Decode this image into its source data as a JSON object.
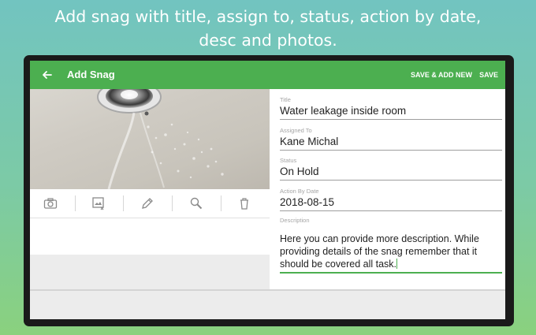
{
  "headline": {
    "line1": "Add snag with title, assign to, status,  action by date,",
    "line2": "desc and photos."
  },
  "appbar": {
    "title": "Add Snag",
    "back_icon": "arrow-back-icon",
    "save_add_new_label": "SAVE & ADD NEW",
    "save_label": "SAVE",
    "color": "#4caf50"
  },
  "photo_toolbar": {
    "icons": [
      "camera-icon",
      "gallery-icon",
      "pencil-icon",
      "zoom-icon",
      "trash-icon"
    ]
  },
  "form": {
    "title": {
      "label": "Title",
      "value": "Water leakage inside room"
    },
    "assigned_to": {
      "label": "Assigned To",
      "value": "Kane Michal"
    },
    "status": {
      "label": "Status",
      "value": "On Hold"
    },
    "action_by_date": {
      "label": "Action By Date",
      "value": "2018-08-15"
    },
    "description": {
      "label": "Description",
      "value": "Here you can provide more description. While providing details of the snag remember that it should be covered all task."
    }
  }
}
